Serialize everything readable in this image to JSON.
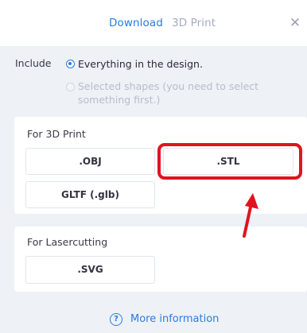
{
  "header": {
    "tabs": [
      {
        "label": "Download",
        "active": true
      },
      {
        "label": "3D Print",
        "active": false
      }
    ],
    "close_icon": "close-icon"
  },
  "include": {
    "label": "Include",
    "options": [
      {
        "label": "Everything in the design.",
        "selected": true,
        "enabled": true
      },
      {
        "label": "Selected shapes (you need to select something first.)",
        "selected": false,
        "enabled": false
      }
    ]
  },
  "sections": {
    "print3d": {
      "title": "For 3D Print",
      "buttons": [
        ".OBJ",
        ".STL",
        "GLTF (.glb)"
      ]
    },
    "laser": {
      "title": "For Lasercutting",
      "buttons": [
        ".SVG"
      ]
    }
  },
  "footer": {
    "more_info": "More information",
    "icon": "help-icon"
  },
  "colors": {
    "accent": "#2a7ce0",
    "highlight": "#e0141e",
    "panel_bg": "#eef1f6"
  }
}
